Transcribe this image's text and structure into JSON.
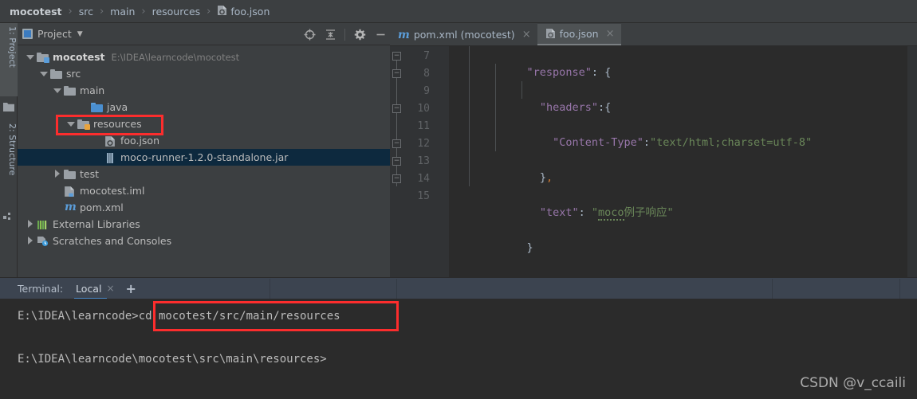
{
  "breadcrumb": {
    "name": "breadcrumb",
    "items": [
      {
        "label": "mocotest",
        "bold": true,
        "icon": ""
      },
      {
        "label": "src",
        "bold": false,
        "icon": ""
      },
      {
        "label": "main",
        "bold": false,
        "icon": ""
      },
      {
        "label": "resources",
        "bold": false,
        "icon": ""
      },
      {
        "label": "foo.json",
        "bold": false,
        "icon": "json-file-icon"
      }
    ],
    "separator": "›"
  },
  "left_strip": {
    "tabs": [
      {
        "label": "1: Project",
        "icon": "project-folder-icon",
        "active": true
      },
      {
        "label": "2: Structure",
        "icon": "structure-icon",
        "active": false
      }
    ]
  },
  "project_panel": {
    "title": "Project",
    "caret": "▾",
    "tools": [
      {
        "name": "locate-icon",
        "glyph": "⊕"
      },
      {
        "name": "collapse-all-icon",
        "glyph": "⨍"
      },
      {
        "name": "settings-gear-icon",
        "glyph": "⚙"
      },
      {
        "name": "hide-panel-icon",
        "glyph": "—"
      }
    ],
    "tree": [
      {
        "indent": 0,
        "arrow": "down",
        "icon": "module-folder-icon",
        "label": "mocotest",
        "bold": true,
        "hint": "E:\\IDEA\\learncode\\mocotest",
        "selected": false
      },
      {
        "indent": 1,
        "arrow": "down",
        "icon": "folder-icon",
        "label": "src",
        "bold": false,
        "hint": "",
        "selected": false
      },
      {
        "indent": 2,
        "arrow": "down",
        "icon": "folder-icon",
        "label": "main",
        "bold": false,
        "hint": "",
        "selected": false
      },
      {
        "indent": 3,
        "arrow": "none",
        "icon": "source-folder-icon",
        "label": "java",
        "bold": false,
        "hint": "",
        "selected": false
      },
      {
        "indent": 3,
        "arrow": "down",
        "icon": "resource-folder-icon",
        "label": "resources",
        "bold": false,
        "hint": "",
        "selected": false
      },
      {
        "indent": 4,
        "arrow": "none",
        "icon": "json-file-icon",
        "label": "foo.json",
        "bold": false,
        "hint": "",
        "selected": false
      },
      {
        "indent": 4,
        "arrow": "none",
        "icon": "jar-file-icon",
        "label": "moco-runner-1.2.0-standalone.jar",
        "bold": false,
        "hint": "",
        "selected": true
      },
      {
        "indent": 2,
        "arrow": "right",
        "icon": "folder-icon",
        "label": "test",
        "bold": false,
        "hint": "",
        "selected": false
      },
      {
        "indent": 2,
        "arrow": "none",
        "icon": "iml-file-icon",
        "label": "mocotest.iml",
        "bold": false,
        "hint": "",
        "selected": false
      },
      {
        "indent": 2,
        "arrow": "none",
        "icon": "maven-file-icon",
        "label": "pom.xml",
        "bold": false,
        "hint": "",
        "selected": false
      },
      {
        "indent": 0,
        "arrow": "right",
        "icon": "libraries-icon",
        "label": "External Libraries",
        "bold": false,
        "hint": "",
        "selected": false
      },
      {
        "indent": 0,
        "arrow": "right",
        "icon": "scratches-icon",
        "label": "Scratches and Consoles",
        "bold": false,
        "hint": "",
        "selected": false
      }
    ]
  },
  "editor": {
    "tabs": [
      {
        "label": "pom.xml (mocotest)",
        "icon": "maven-file-icon",
        "active": false,
        "close": "×"
      },
      {
        "label": "foo.json",
        "icon": "json-file-icon",
        "active": true,
        "close": "×"
      }
    ],
    "first_line_number": 7,
    "lines": [
      {
        "num": 7,
        "fold": "collapse-top",
        "text": "    \"response\": {"
      },
      {
        "num": 8,
        "fold": "collapse-top",
        "text": "      \"headers\":{"
      },
      {
        "num": 9,
        "fold": "",
        "text": "        \"Content-Type\":\"text/html;charset=utf-8\""
      },
      {
        "num": 10,
        "fold": "collapse-end",
        "text": "      },"
      },
      {
        "num": 11,
        "fold": "",
        "text": "      \"text\": \"moco例子响应\""
      },
      {
        "num": 12,
        "fold": "collapse-end",
        "text": "    }"
      },
      {
        "num": 13,
        "fold": "collapse-end",
        "text": "  }"
      },
      {
        "num": 14,
        "fold": "collapse-end",
        "text": "]"
      },
      {
        "num": 15,
        "fold": "",
        "text": ""
      }
    ]
  },
  "terminal": {
    "label": "Terminal:",
    "tab": "Local",
    "tab_close": "×",
    "add_tab": "+",
    "lines": [
      {
        "prompt": "E:\\IDEA\\learncode>",
        "command": "cd mocotest/src/main/resources"
      },
      {
        "prompt": "",
        "command": ""
      },
      {
        "prompt": "E:\\IDEA\\learncode\\mocotest\\src\\main\\resources>",
        "command": ""
      }
    ]
  },
  "watermark": "CSDN @v_ccaili",
  "annotations": [
    {
      "name": "resources-highlight-box",
      "color": "#fc2d2d"
    },
    {
      "name": "cd-command-highlight-box",
      "color": "#fc2d2d"
    }
  ]
}
